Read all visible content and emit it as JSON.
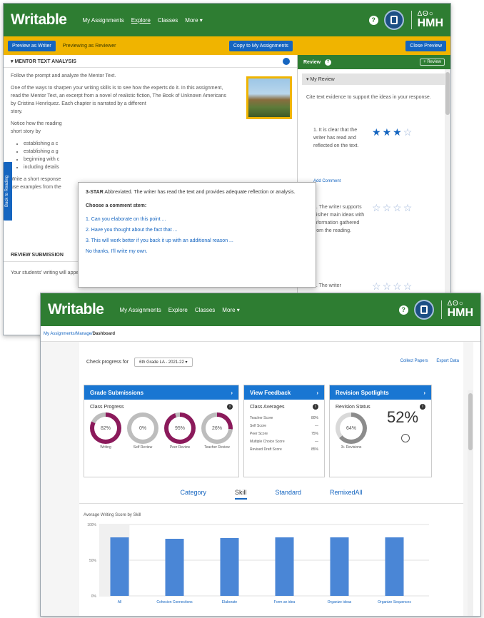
{
  "top_window": {
    "nav": {
      "logo": "Writable",
      "links": [
        "My Assignments",
        "Explore",
        "Classes",
        "More"
      ],
      "help": "?",
      "brand_shapes": "ΔΘ○",
      "brand": "HMH"
    },
    "yellowbar": {
      "preview_button": "Preview as Writer",
      "status_text": "Previewing as Reviewer",
      "copy_button": "Copy to My Assignments",
      "close_button": "Close Preview"
    },
    "mentor": {
      "heading": "▾ MENTOR TEXT ANALYSIS",
      "para1": "Follow the prompt and analyze the Mentor Text.",
      "para2": "One of the ways to sharpen your writing skills is to see how the experts do it. In this assignment, read the Mentor Text, an excerpt from a novel of realistic fiction, The Book of Unknown Americans by Cristina Henríquez. Each chapter is narrated by a different",
      "para2b": "story.",
      "para3": "Notice how the reading",
      "para3b": "short story by",
      "bullets": [
        "establishing a c",
        "establishing a g",
        "beginning with c",
        "including details"
      ],
      "para4": "Write a short response",
      "para4b": "use examples from the"
    },
    "side_tab": "Back to Reading",
    "review_submission": {
      "heading": "REVIEW SUBMISSION",
      "body": "Your students' writing will appear here."
    },
    "popover": {
      "rating_label": "3-STAR",
      "rating_text": "Abbreviated. The writer has read the text and provides adequate reflection or analysis.",
      "choose": "Choose a comment stem:",
      "stems": [
        "1. Can you elaborate on this point ...",
        "2. Have you thought about the fact that ...",
        "3. This will work better if you back it up with an additional reason ...",
        "No thanks, I'll write my own."
      ]
    },
    "review_pane": {
      "title": "Review",
      "help": "?",
      "button": "+ Review",
      "my_review": "▾ My Review",
      "cite": "Cite text evidence to support the ideas in your response.",
      "criteria": [
        {
          "text": "1. It is clear that the writer has read and reflected on the text.",
          "stars": 3
        },
        {
          "text": "2. The writer supports his/her main ideas with information gathered from the reading.",
          "stars": 0
        },
        {
          "text": "3. The writer",
          "stars": 0
        }
      ],
      "add_comment": "Add Comment"
    }
  },
  "bottom_window": {
    "nav": {
      "logo": "Writable",
      "links": [
        "My Assignments",
        "Explore",
        "Classes",
        "More"
      ],
      "help": "?",
      "brand_shapes": "ΔΘ○",
      "brand": "HMH"
    },
    "breadcrumb": {
      "items": [
        "My Assignments",
        "Manage"
      ],
      "current": "Dashboard",
      "sep": " / "
    },
    "check_progress": "Check progress for",
    "class_select": "6th Grade LA - 2021-22",
    "links": [
      "Collect Papers",
      "Export Data"
    ],
    "cards": {
      "grade": {
        "title": "Grade Submissions",
        "subtitle": "Class Progress",
        "rings": [
          {
            "label": "Writing",
            "pct": 0.82,
            "value": "82%",
            "color": "#8b1a5b"
          },
          {
            "label": "Self Review",
            "pct": 0.0,
            "value": "0%",
            "color": "#8b1a5b"
          },
          {
            "label": "Peer Review",
            "pct": 0.95,
            "value": "95%",
            "color": "#8b1a5b"
          },
          {
            "label": "Teacher Review",
            "pct": 0.26,
            "value": "26%",
            "color": "#8b1a5b"
          }
        ]
      },
      "feedback": {
        "title": "View Feedback",
        "subtitle": "Class Averages",
        "rows": [
          {
            "label": "Teacher Score",
            "value": "80%"
          },
          {
            "label": "Self Score",
            "value": "—"
          },
          {
            "label": "Peer Score",
            "value": "75%"
          },
          {
            "label": "Multiple Choice Score",
            "value": "—"
          },
          {
            "label": "Revised Draft Score",
            "value": "85%"
          }
        ]
      },
      "revision": {
        "title": "Revision Spotlights",
        "subtitle": "Revision Status",
        "ring_value": "64%",
        "ring_pct": 0.64,
        "ring_label": "3+ Revisions",
        "big_value": "52%"
      },
      "chevron": "›",
      "info": "i"
    },
    "tabs": [
      "Category",
      "Skill",
      "Standard",
      "RemixedAll"
    ],
    "active_tab": 1,
    "chart_data": {
      "type": "bar",
      "title": "Average Writing Score by Skill",
      "categories": [
        "All",
        "Cohesion Connections",
        "Elaborate",
        "Form an idea",
        "Organize ideas",
        "Organize Sequences"
      ],
      "values": [
        82,
        80,
        81,
        82,
        82,
        82
      ],
      "ylim": [
        0,
        100
      ],
      "yticks": [
        "0%",
        "50%",
        "100%"
      ],
      "color": "#4a86d6",
      "grid": true
    }
  }
}
